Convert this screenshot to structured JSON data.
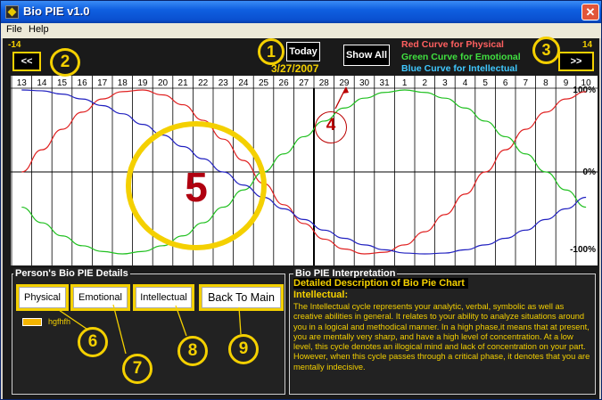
{
  "window": {
    "title": "Bio PIE v1.0",
    "close_glyph": "✕"
  },
  "menu": {
    "file": "File",
    "help": "Help"
  },
  "header": {
    "left_range": "-14",
    "right_range": "14",
    "prev_label": "<<",
    "next_label": ">>",
    "today_label": "Today",
    "date": "3/27/2007",
    "show_all_label": "Show All",
    "legend": [
      {
        "text": "Red Curve for Physical",
        "color": "#ff6060"
      },
      {
        "text": "Green Curve for Emotional",
        "color": "#40e040"
      },
      {
        "text": "Blue Curve for Intellectual",
        "color": "#40c8ff"
      }
    ]
  },
  "chart_data": {
    "type": "line",
    "x": [
      "13",
      "14",
      "15",
      "16",
      "17",
      "18",
      "19",
      "20",
      "21",
      "22",
      "23",
      "24",
      "25",
      "26",
      "27",
      "28",
      "29",
      "30",
      "31",
      "1",
      "2",
      "3",
      "4",
      "5",
      "6",
      "7",
      "8",
      "9",
      "10"
    ],
    "ylim": [
      -100,
      100
    ],
    "y_ticks": [
      "100%",
      "0%",
      "-100%"
    ],
    "today_index": 14,
    "series": [
      {
        "color": "#e02020",
        "values": [
          0,
          27,
          52,
          73,
          89,
          98,
          100,
          94,
          82,
          63,
          40,
          14,
          -14,
          -40,
          -63,
          -82,
          -94,
          -100,
          -98,
          -89,
          -73,
          -52,
          -27,
          0,
          27,
          52,
          73,
          89,
          98
        ]
      },
      {
        "color": "#20c020",
        "values": [
          -43,
          -62,
          -78,
          -90,
          -97,
          -100,
          -97,
          -90,
          -78,
          -62,
          -43,
          -22,
          0,
          22,
          43,
          62,
          78,
          90,
          97,
          100,
          97,
          90,
          78,
          62,
          43,
          22,
          0,
          -22,
          -43
        ]
      },
      {
        "color": "#2020c0",
        "values": [
          100,
          99,
          95,
          89,
          81,
          71,
          58,
          45,
          31,
          16,
          0,
          -16,
          -31,
          -45,
          -58,
          -71,
          -81,
          -89,
          -95,
          -99,
          -100,
          -99,
          -95,
          -89,
          -81,
          -71,
          -58,
          -45,
          -31
        ]
      }
    ]
  },
  "annotations": {
    "n1": "1",
    "n2": "2",
    "n3": "3",
    "n4": "4",
    "n5": "5",
    "n6": "6",
    "n7": "7",
    "n8": "8",
    "n9": "9"
  },
  "details": {
    "title": "Person's Bio PIE Details",
    "buttons": {
      "physical": "Physical",
      "emotional": "Emotional",
      "intellectual": "Intellectual",
      "back": "Back To Main"
    },
    "person_name": "hgfhfh",
    "person_color": "#f4b400"
  },
  "interpretation": {
    "title": "Bio PIE Interpretation",
    "heading": "Detailed Description of Bio Pie Chart",
    "subheading": "Intellectual:",
    "body": "The Intellectual cycle represents your analytic, verbal, symbolic as well as creative abilities in general. It relates to your ability to analyze situations around you in a logical and methodical manner. In a high phase,it means that at present, you are mentally very sharp, and have a high level of concentration. At a low level, this cycle denotes an illogical mind and lack of concentration on your part. However, when this cycle passes through a critical phase, it denotes that you are mentally indecisive."
  }
}
